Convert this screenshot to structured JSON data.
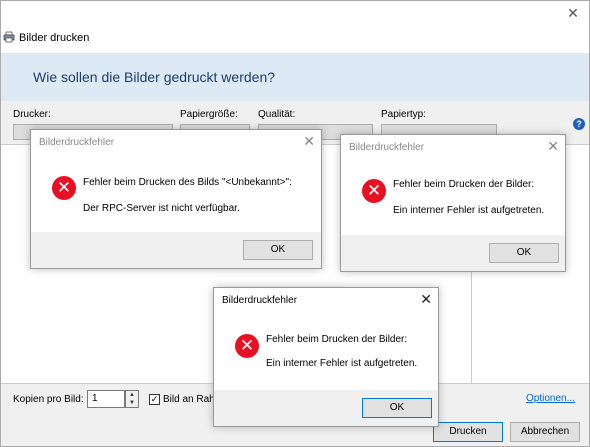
{
  "window": {
    "title": "Bilder drucken",
    "heading": "Wie sollen die Bilder gedruckt werden?"
  },
  "options": {
    "printer_label": "Drucker:",
    "paper_size_label": "Papiergröße:",
    "quality_label": "Qualität:",
    "paper_type_label": "Papiertyp:",
    "help_glyph": "?"
  },
  "footer": {
    "copies_label": "Kopien pro Bild:",
    "copies_value": "1",
    "fit_checked": true,
    "fit_label": "Bild an Rahm",
    "options_link": "Optionen...",
    "print_button": "Drucken",
    "cancel_button": "Abbrechen"
  },
  "dialogs": [
    {
      "title": "Bilderdruckfehler",
      "line1": "Fehler beim Drucken des Bilds \"<Unbekannt>\":",
      "line2": "Der RPC-Server ist nicht verfügbar.",
      "ok": "OK",
      "active": false
    },
    {
      "title": "Bilderdruckfehler",
      "line1": "Fehler beim Drucken der Bilder:",
      "line2": "Ein interner Fehler ist aufgetreten.",
      "ok": "OK",
      "active": false
    },
    {
      "title": "Bilderdruckfehler",
      "line1": "Fehler beim Drucken der Bilder:",
      "line2": "Ein interner Fehler ist aufgetreten.",
      "ok": "OK",
      "active": true
    }
  ],
  "colors": {
    "accent": "#0078d7",
    "error": "#e81123",
    "banner": "#dde9f5",
    "heading_text": "#1e3d6b",
    "link": "#0066cc"
  },
  "icons": {
    "window_close": "close-icon",
    "app": "printer-icon",
    "help": "help-icon",
    "error": "error-icon"
  }
}
